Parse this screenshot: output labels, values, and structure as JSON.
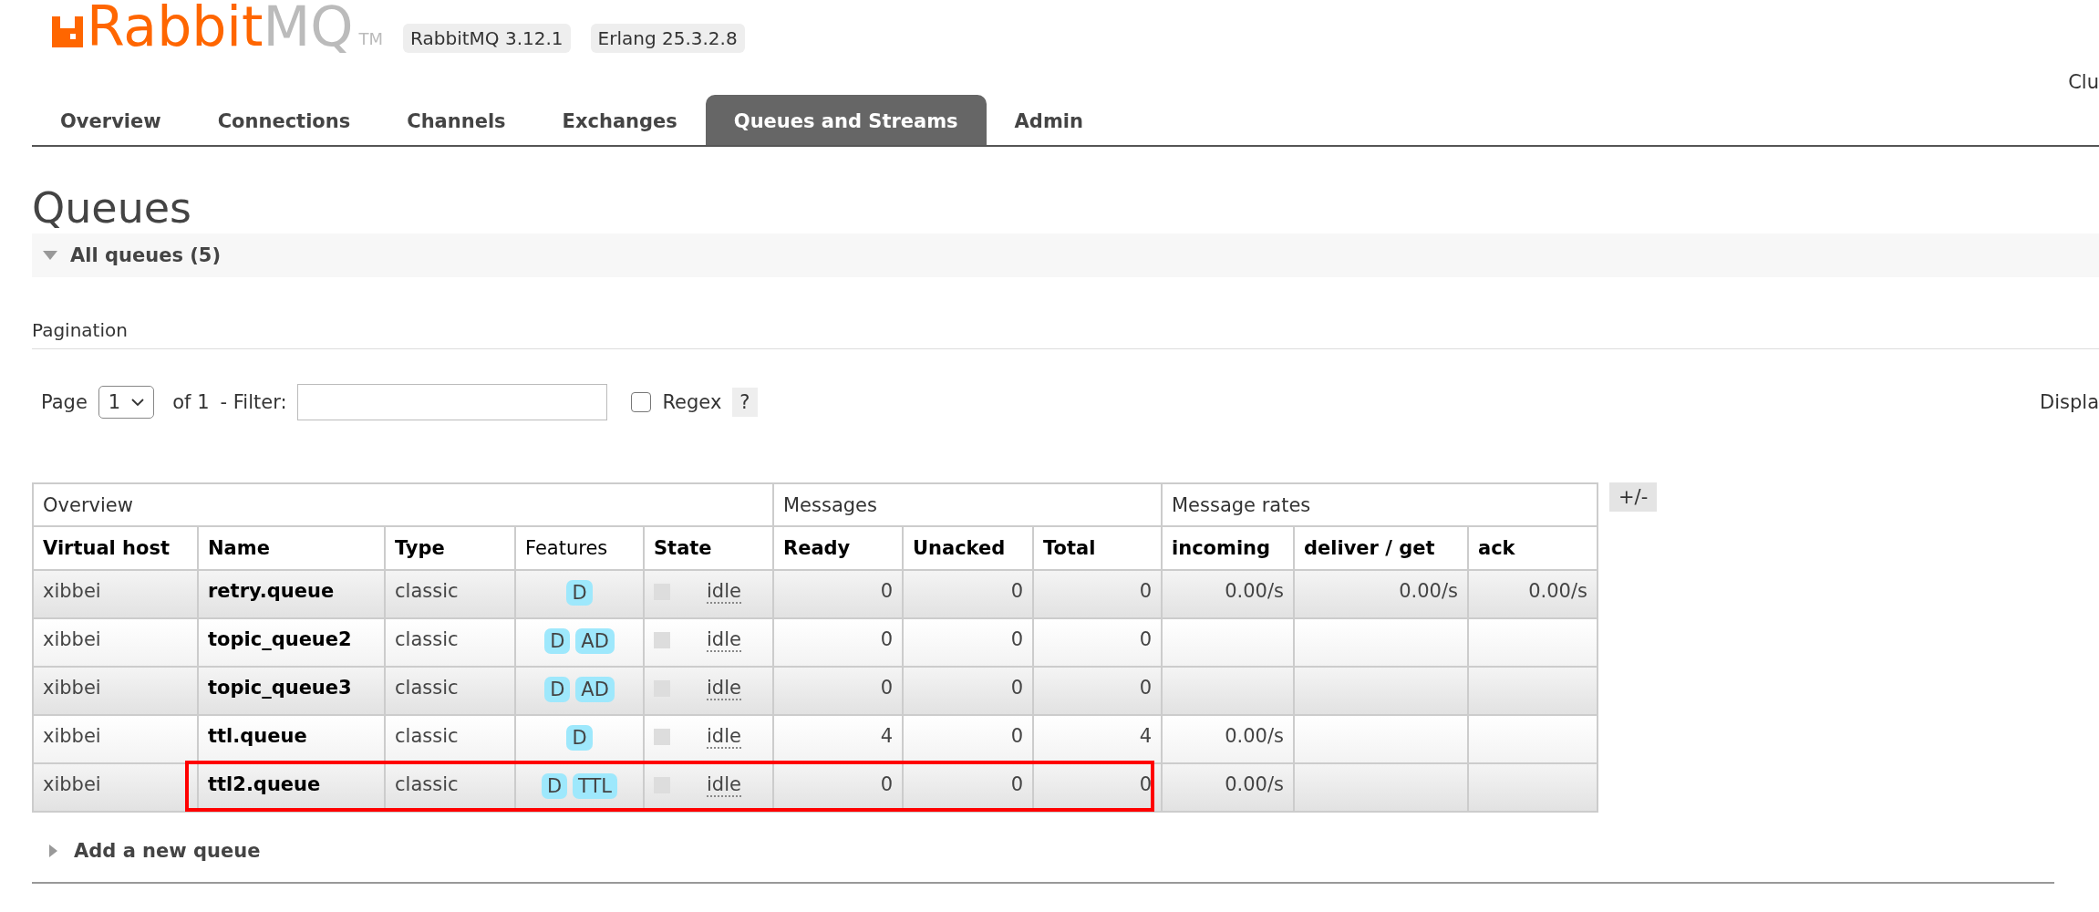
{
  "header": {
    "logo_text": "Rabbit",
    "logo_text_suffix": "MQ",
    "trademark": "TM",
    "versions": [
      "RabbitMQ 3.12.1",
      "Erlang 25.3.2.8"
    ],
    "cluster_label": "Clu"
  },
  "tabs": [
    {
      "label": "Overview",
      "selected": false
    },
    {
      "label": "Connections",
      "selected": false
    },
    {
      "label": "Channels",
      "selected": false
    },
    {
      "label": "Exchanges",
      "selected": false
    },
    {
      "label": "Queues and Streams",
      "selected": true
    },
    {
      "label": "Admin",
      "selected": false
    }
  ],
  "page_title": "Queues",
  "section": {
    "title": "All queues (5)",
    "expanded": true
  },
  "pagination": {
    "heading": "Pagination",
    "page_label": "Page",
    "page_value": "1",
    "of_label": "of 1",
    "filter_label": "- Filter:",
    "regex_label": "Regex",
    "regex_checked": false,
    "help": "?",
    "display_label": "Displa"
  },
  "table": {
    "groups": [
      {
        "label": "Overview"
      },
      {
        "label": "Messages"
      },
      {
        "label": "Message rates"
      }
    ],
    "columns": [
      {
        "label": "Virtual host",
        "bold": true
      },
      {
        "label": "Name",
        "bold": true
      },
      {
        "label": "Type",
        "bold": true
      },
      {
        "label": "Features",
        "bold": false
      },
      {
        "label": "State",
        "bold": true
      },
      {
        "label": "Ready",
        "bold": true
      },
      {
        "label": "Unacked",
        "bold": true
      },
      {
        "label": "Total",
        "bold": true
      },
      {
        "label": "incoming",
        "bold": true
      },
      {
        "label": "deliver / get",
        "bold": true
      },
      {
        "label": "ack",
        "bold": true
      }
    ],
    "columns_toggle": "+/-",
    "rows": [
      {
        "vhost": "xibbei",
        "name": "retry.queue",
        "type": "classic",
        "features": [
          "D"
        ],
        "state": "idle",
        "ready": "0",
        "unacked": "0",
        "total": "0",
        "incoming": "0.00/s",
        "deliver_get": "0.00/s",
        "ack": "0.00/s",
        "highlighted": false
      },
      {
        "vhost": "xibbei",
        "name": "topic_queue2",
        "type": "classic",
        "features": [
          "D",
          "AD"
        ],
        "state": "idle",
        "ready": "0",
        "unacked": "0",
        "total": "0",
        "highlighted": false
      },
      {
        "vhost": "xibbei",
        "name": "topic_queue3",
        "type": "classic",
        "features": [
          "D",
          "AD"
        ],
        "state": "idle",
        "ready": "0",
        "unacked": "0",
        "total": "0",
        "highlighted": false
      },
      {
        "vhost": "xibbei",
        "name": "ttl.queue",
        "type": "classic",
        "features": [
          "D"
        ],
        "state": "idle",
        "ready": "4",
        "unacked": "0",
        "total": "4",
        "incoming": "0.00/s",
        "highlighted": false
      },
      {
        "vhost": "xibbei",
        "name": "ttl2.queue",
        "type": "classic",
        "features": [
          "D",
          "TTL"
        ],
        "state": "idle",
        "ready": "0",
        "unacked": "0",
        "total": "0",
        "incoming": "0.00/s",
        "highlighted": true
      }
    ]
  },
  "add_section": {
    "title": "Add a new queue",
    "expanded": false
  }
}
